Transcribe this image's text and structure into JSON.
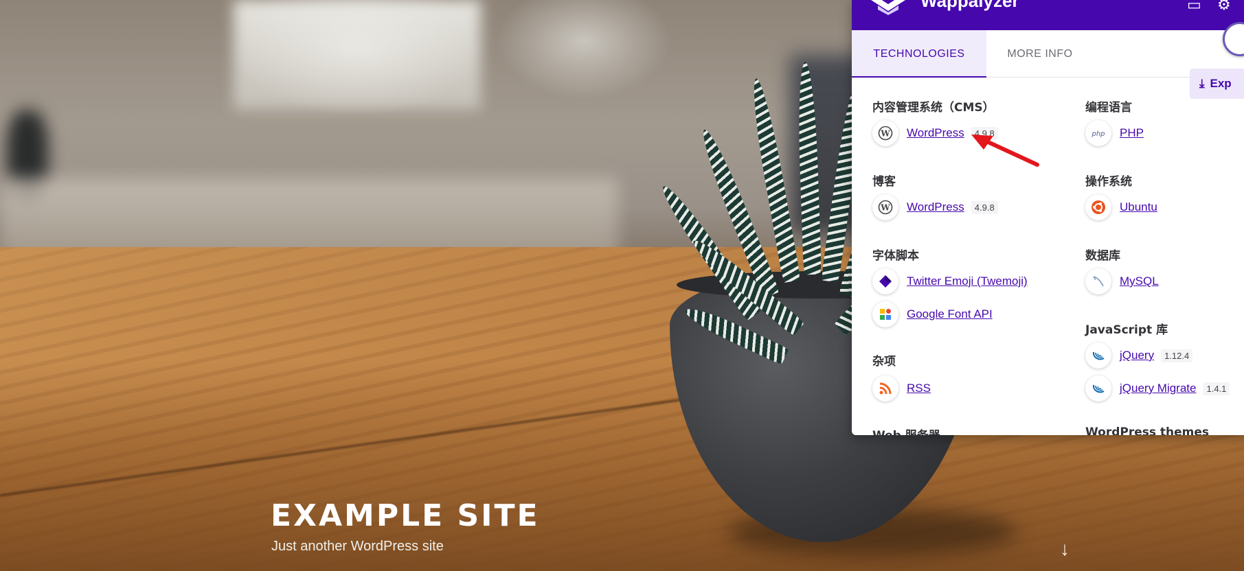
{
  "site": {
    "title": "EXAMPLE SITE",
    "tagline": "Just another WordPress site",
    "scroll_icon": "down-arrow-icon"
  },
  "popup": {
    "brand": "Wappalyzer",
    "header_icons": [
      "toggle-icon",
      "gear-icon"
    ],
    "tabs": [
      {
        "label": "TECHNOLOGIES",
        "active": true
      },
      {
        "label": "MORE INFO",
        "active": false
      }
    ],
    "export_label": "Exp",
    "colors": {
      "brand": "#4608ad",
      "tab_active_bg": "#f1ecfb"
    },
    "left_column": [
      {
        "category": "内容管理系统（CMS）",
        "items": [
          {
            "name": "WordPress",
            "version": "4.9.8",
            "icon": "wordpress-icon"
          }
        ]
      },
      {
        "category": "博客",
        "items": [
          {
            "name": "WordPress",
            "version": "4.9.8",
            "icon": "wordpress-icon"
          }
        ]
      },
      {
        "category": "字体脚本",
        "items": [
          {
            "name": "Twitter Emoji (Twemoji)",
            "version": "",
            "icon": "twemoji-icon"
          },
          {
            "name": "Google Font API",
            "version": "",
            "icon": "google-fonts-icon"
          }
        ]
      },
      {
        "category": "杂项",
        "items": [
          {
            "name": "RSS",
            "version": "",
            "icon": "rss-icon"
          }
        ]
      },
      {
        "category": "Web 服务器",
        "items": []
      }
    ],
    "right_column": [
      {
        "category": "编程语言",
        "items": [
          {
            "name": "PHP",
            "version": "",
            "icon": "php-icon"
          }
        ]
      },
      {
        "category": "操作系统",
        "items": [
          {
            "name": "Ubuntu",
            "version": "",
            "icon": "ubuntu-icon"
          }
        ]
      },
      {
        "category": "数据库",
        "items": [
          {
            "name": "MySQL",
            "version": "",
            "icon": "mysql-icon"
          }
        ]
      },
      {
        "category": "JavaScript 库",
        "items": [
          {
            "name": "jQuery",
            "version": "1.12.4",
            "icon": "jquery-icon"
          },
          {
            "name": "jQuery Migrate",
            "version": "1.4.1",
            "icon": "jquery-icon"
          }
        ]
      },
      {
        "category": "WordPress themes",
        "items": []
      }
    ]
  }
}
